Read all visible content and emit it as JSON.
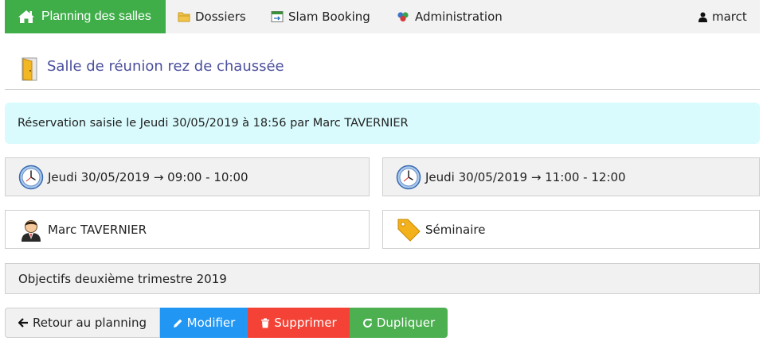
{
  "nav": {
    "home": {
      "label": "Planning des salles",
      "icon": "home-icon"
    },
    "dossiers": {
      "label": "Dossiers",
      "icon": "folder-icon"
    },
    "slam": {
      "label": "Slam Booking",
      "icon": "calendar-icon"
    },
    "admin": {
      "label": "Administration",
      "icon": "molecule-icon"
    },
    "user": {
      "label": "marct",
      "icon": "user-icon"
    }
  },
  "room": {
    "title": "Salle de réunion rez de chaussée",
    "icon": "door-icon"
  },
  "info": {
    "text": "Réservation saisie le Jeudi 30/05/2019 à 18:56 par Marc TAVERNIER"
  },
  "slots": [
    {
      "text": "Jeudi 30/05/2019 → 09:00 - 10:00",
      "icon": "clock-icon"
    },
    {
      "text": "Jeudi 30/05/2019 → 11:00 - 12:00",
      "icon": "clock-icon"
    }
  ],
  "person": {
    "text": "Marc TAVERNIER",
    "icon": "person-icon"
  },
  "category": {
    "text": "Séminaire",
    "icon": "tag-icon"
  },
  "description": {
    "text": "Objectifs deuxième trimestre 2019"
  },
  "actions": {
    "back": {
      "label": "Retour au planning",
      "icon": "arrow-left-icon"
    },
    "edit": {
      "label": "Modifier",
      "icon": "pencil-icon"
    },
    "delete": {
      "label": "Supprimer",
      "icon": "trash-icon"
    },
    "duplicate": {
      "label": "Dupliquer",
      "icon": "refresh-icon"
    }
  },
  "colors": {
    "nav_active": "#3fae49",
    "info_bg": "#d9fbfd",
    "title_text": "#4a4f9c",
    "edit": "#2196f3",
    "delete": "#f44336",
    "duplicate": "#4caf50"
  }
}
